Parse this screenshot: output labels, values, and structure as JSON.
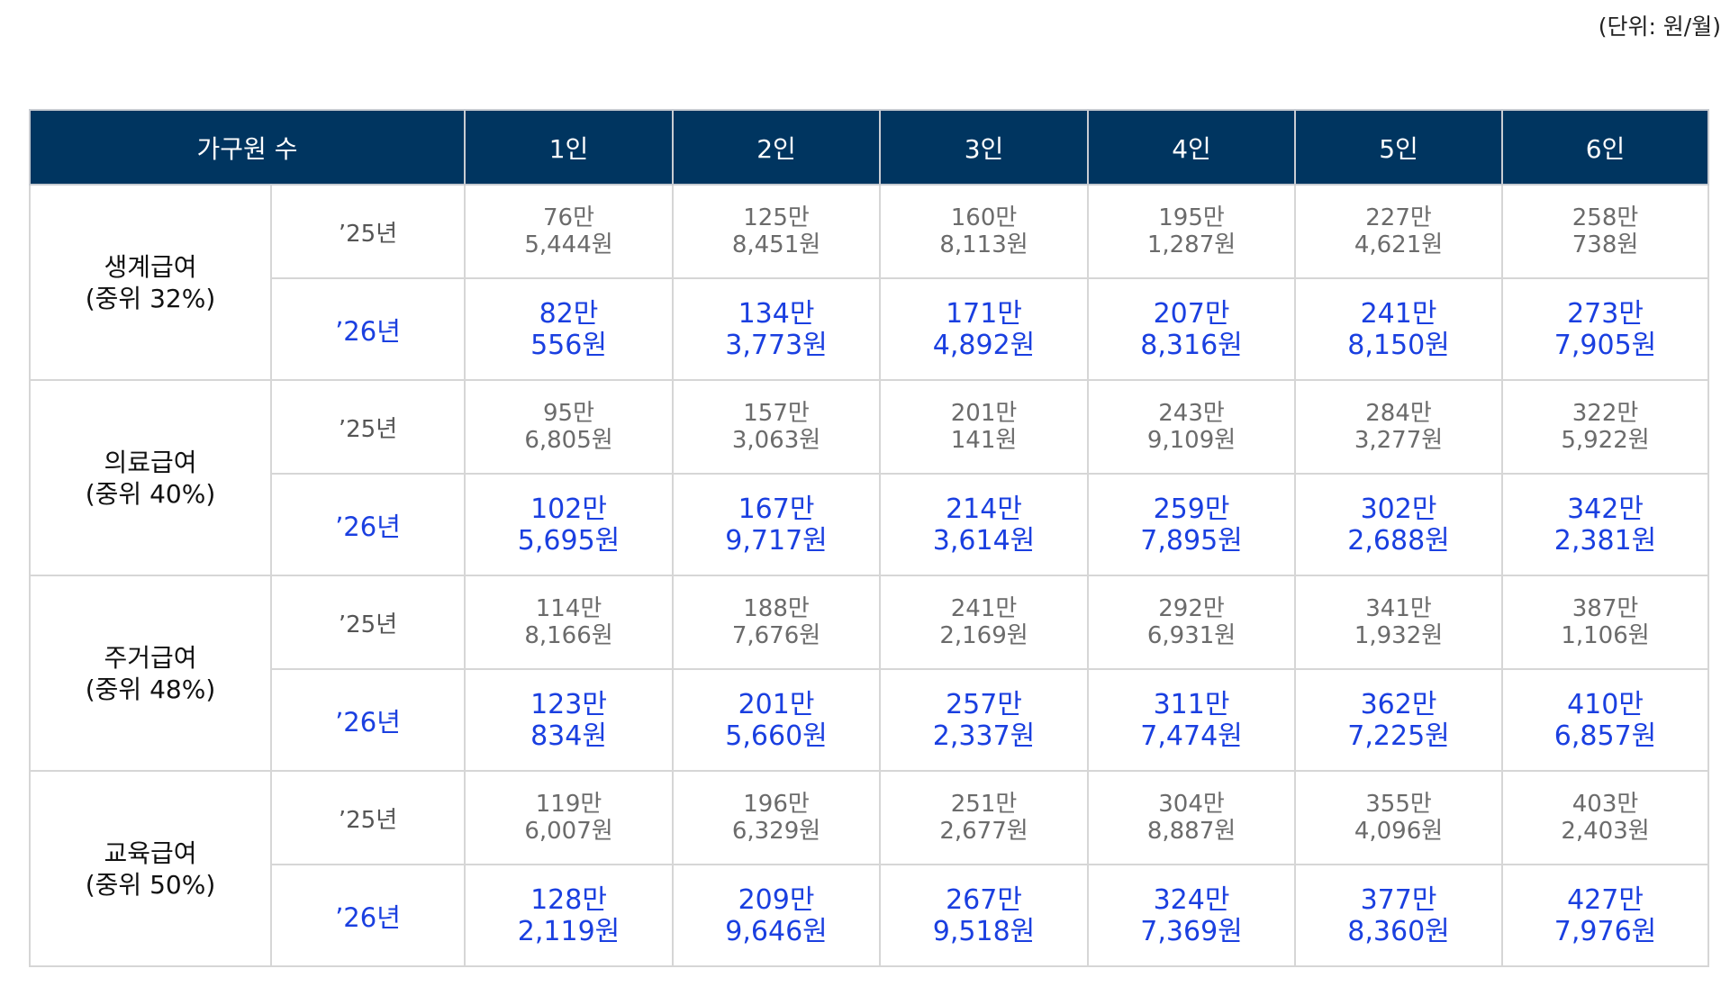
{
  "unit_note": "(단위: 원/월)",
  "header": {
    "label": "가구원 수",
    "sizes": [
      "1인",
      "2인",
      "3인",
      "4인",
      "5인",
      "6인"
    ]
  },
  "groups": [
    {
      "name": "생계급여",
      "criterion": "(중위 32%)",
      "rows": [
        {
          "year": "’25년",
          "values": [
            [
              "76만",
              "5,444원"
            ],
            [
              "125만",
              "8,451원"
            ],
            [
              "160만",
              "8,113원"
            ],
            [
              "195만",
              "1,287원"
            ],
            [
              "227만",
              "4,621원"
            ],
            [
              "258만",
              "738원"
            ]
          ]
        },
        {
          "year": "’26년",
          "values": [
            [
              "82만",
              "556원"
            ],
            [
              "134만",
              "3,773원"
            ],
            [
              "171만",
              "4,892원"
            ],
            [
              "207만",
              "8,316원"
            ],
            [
              "241만",
              "8,150원"
            ],
            [
              "273만",
              "7,905원"
            ]
          ]
        }
      ]
    },
    {
      "name": "의료급여",
      "criterion": "(중위 40%)",
      "rows": [
        {
          "year": "’25년",
          "values": [
            [
              "95만",
              "6,805원"
            ],
            [
              "157만",
              "3,063원"
            ],
            [
              "201만",
              "141원"
            ],
            [
              "243만",
              "9,109원"
            ],
            [
              "284만",
              "3,277원"
            ],
            [
              "322만",
              "5,922원"
            ]
          ]
        },
        {
          "year": "’26년",
          "values": [
            [
              "102만",
              "5,695원"
            ],
            [
              "167만",
              "9,717원"
            ],
            [
              "214만",
              "3,614원"
            ],
            [
              "259만",
              "7,895원"
            ],
            [
              "302만",
              "2,688원"
            ],
            [
              "342만",
              "2,381원"
            ]
          ]
        }
      ]
    },
    {
      "name": "주거급여",
      "criterion": "(중위 48%)",
      "rows": [
        {
          "year": "’25년",
          "values": [
            [
              "114만",
              "8,166원"
            ],
            [
              "188만",
              "7,676원"
            ],
            [
              "241만",
              "2,169원"
            ],
            [
              "292만",
              "6,931원"
            ],
            [
              "341만",
              "1,932원"
            ],
            [
              "387만",
              "1,106원"
            ]
          ]
        },
        {
          "year": "’26년",
          "values": [
            [
              "123만",
              "834원"
            ],
            [
              "201만",
              "5,660원"
            ],
            [
              "257만",
              "2,337원"
            ],
            [
              "311만",
              "7,474원"
            ],
            [
              "362만",
              "7,225원"
            ],
            [
              "410만",
              "6,857원"
            ]
          ]
        }
      ]
    },
    {
      "name": "교육급여",
      "criterion": "(중위 50%)",
      "rows": [
        {
          "year": "’25년",
          "values": [
            [
              "119만",
              "6,007원"
            ],
            [
              "196만",
              "6,329원"
            ],
            [
              "251만",
              "2,677원"
            ],
            [
              "304만",
              "8,887원"
            ],
            [
              "355만",
              "4,096원"
            ],
            [
              "403만",
              "2,403원"
            ]
          ]
        },
        {
          "year": "’26년",
          "values": [
            [
              "128만",
              "2,119원"
            ],
            [
              "209만",
              "9,646원"
            ],
            [
              "267만",
              "9,518원"
            ],
            [
              "324만",
              "7,369원"
            ],
            [
              "377만",
              "8,360원"
            ],
            [
              "427만",
              "7,976원"
            ]
          ]
        }
      ]
    }
  ],
  "colors": {
    "header_bg": "#003560",
    "current_year": "#1a3fe0",
    "previous_year": "#6b6b6b"
  }
}
